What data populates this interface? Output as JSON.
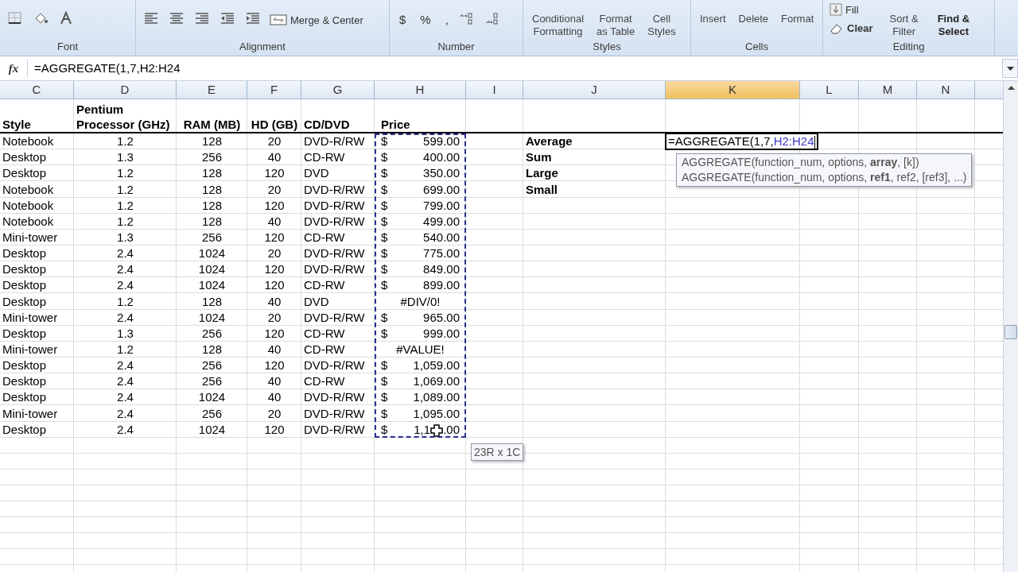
{
  "ribbon": {
    "groups": [
      {
        "label": "Font",
        "items": [
          {
            "kind": "icon"
          },
          {
            "kind": "icon"
          },
          {
            "kind": "icon"
          }
        ]
      },
      {
        "label": "Alignment",
        "items": [
          {
            "kind": "icon"
          },
          {
            "kind": "icon"
          },
          {
            "kind": "icon"
          },
          {
            "kind": "icon"
          },
          {
            "kind": "icon"
          },
          {
            "kind": "text",
            "label": "Merge & Center"
          }
        ]
      },
      {
        "label": "Number",
        "items": [
          {
            "kind": "symbol",
            "label": "$"
          },
          {
            "kind": "symbol",
            "label": "%"
          },
          {
            "kind": "symbol",
            "label": ","
          },
          {
            "kind": "icon"
          },
          {
            "kind": "icon"
          }
        ]
      },
      {
        "label": "Styles",
        "items": [
          {
            "kind": "stack",
            "label": "Conditional",
            "sub": "Formatting"
          },
          {
            "kind": "stack",
            "label": "Format",
            "sub": "as Table"
          },
          {
            "kind": "stack",
            "label": "Cell",
            "sub": "Styles"
          }
        ]
      },
      {
        "label": "Cells",
        "items": [
          {
            "kind": "stack",
            "label": "Insert"
          },
          {
            "kind": "stack",
            "label": "Delete"
          },
          {
            "kind": "stack",
            "label": "Format"
          }
        ]
      },
      {
        "label": "Editing",
        "items": [
          {
            "kind": "editing",
            "fill": "Fill",
            "clear": "Clear",
            "sort": "Sort &",
            "sort_sub": "Filter",
            "find": "Find &",
            "find_sub": "Select"
          }
        ]
      }
    ]
  },
  "formula_bar": {
    "fx": "fx",
    "formula": "=AGGREGATE(1,7,H2:H24"
  },
  "columns": [
    "C",
    "D",
    "E",
    "F",
    "G",
    "H",
    "I",
    "J",
    "K",
    "L",
    "M",
    "N"
  ],
  "header": {
    "style": "Style",
    "processor_1": "Pentium",
    "processor_2": "Processor (GHz)",
    "ram": "RAM (MB)",
    "hd": "HD (GB)",
    "drive": "CD/DVD",
    "price": "Price"
  },
  "rows": [
    {
      "style": "Notebook",
      "ghz": "1.2",
      "ram": "128",
      "hd": "20",
      "drive": "DVD-R/RW",
      "currency": "$",
      "amount": "599.00",
      "label": "Average"
    },
    {
      "style": "Desktop",
      "ghz": "1.3",
      "ram": "256",
      "hd": "40",
      "drive": "CD-RW",
      "currency": "$",
      "amount": "400.00",
      "label": "Sum"
    },
    {
      "style": "Desktop",
      "ghz": "1.2",
      "ram": "128",
      "hd": "120",
      "drive": "DVD",
      "currency": "$",
      "amount": "350.00",
      "label": "Large"
    },
    {
      "style": "Notebook",
      "ghz": "1.2",
      "ram": "128",
      "hd": "20",
      "drive": "DVD-R/RW",
      "currency": "$",
      "amount": "699.00",
      "label": "Small"
    },
    {
      "style": "Notebook",
      "ghz": "1.2",
      "ram": "128",
      "hd": "120",
      "drive": "DVD-R/RW",
      "currency": "$",
      "amount": "799.00"
    },
    {
      "style": "Notebook",
      "ghz": "1.2",
      "ram": "128",
      "hd": "40",
      "drive": "DVD-R/RW",
      "currency": "$",
      "amount": "499.00"
    },
    {
      "style": "Mini-tower",
      "ghz": "1.3",
      "ram": "256",
      "hd": "120",
      "drive": "CD-RW",
      "currency": "$",
      "amount": "540.00"
    },
    {
      "style": "Desktop",
      "ghz": "2.4",
      "ram": "1024",
      "hd": "20",
      "drive": "DVD-R/RW",
      "currency": "$",
      "amount": "775.00"
    },
    {
      "style": "Desktop",
      "ghz": "2.4",
      "ram": "1024",
      "hd": "120",
      "drive": "DVD-R/RW",
      "currency": "$",
      "amount": "849.00"
    },
    {
      "style": "Desktop",
      "ghz": "2.4",
      "ram": "1024",
      "hd": "120",
      "drive": "CD-RW",
      "currency": "$",
      "amount": "899.00"
    },
    {
      "style": "Desktop",
      "ghz": "1.2",
      "ram": "128",
      "hd": "40",
      "drive": "DVD",
      "error": "#DIV/0!"
    },
    {
      "style": "Mini-tower",
      "ghz": "2.4",
      "ram": "1024",
      "hd": "20",
      "drive": "DVD-R/RW",
      "currency": "$",
      "amount": "965.00"
    },
    {
      "style": "Desktop",
      "ghz": "1.3",
      "ram": "256",
      "hd": "120",
      "drive": "CD-RW",
      "currency": "$",
      "amount": "999.00"
    },
    {
      "style": "Mini-tower",
      "ghz": "1.2",
      "ram": "128",
      "hd": "40",
      "drive": "CD-RW",
      "error": "#VALUE!"
    },
    {
      "style": "Desktop",
      "ghz": "2.4",
      "ram": "256",
      "hd": "120",
      "drive": "DVD-R/RW",
      "currency": "$",
      "amount": "1,059.00"
    },
    {
      "style": "Desktop",
      "ghz": "2.4",
      "ram": "256",
      "hd": "40",
      "drive": "CD-RW",
      "currency": "$",
      "amount": "1,069.00"
    },
    {
      "style": "Desktop",
      "ghz": "2.4",
      "ram": "1024",
      "hd": "40",
      "drive": "DVD-R/RW",
      "currency": "$",
      "amount": "1,089.00"
    },
    {
      "style": "Mini-tower",
      "ghz": "2.4",
      "ram": "256",
      "hd": "20",
      "drive": "DVD-R/RW",
      "currency": "$",
      "amount": "1,095.00"
    },
    {
      "style": "Desktop",
      "ghz": "2.4",
      "ram": "1024",
      "hd": "120",
      "drive": "DVD-R/RW",
      "currency": "$",
      "amount": "1,1",
      "amount_tail": ".00"
    }
  ],
  "active_cell": {
    "text": "=AGGREGATE(1,7,",
    "ref": "H2:H24"
  },
  "function_tip": [
    "AGGREGATE(function_num, options, **array**, [k])",
    "AGGREGATE(function_num, options, **ref1**, ref2, [ref3], ...)"
  ],
  "range_tip": "23R x 1C"
}
